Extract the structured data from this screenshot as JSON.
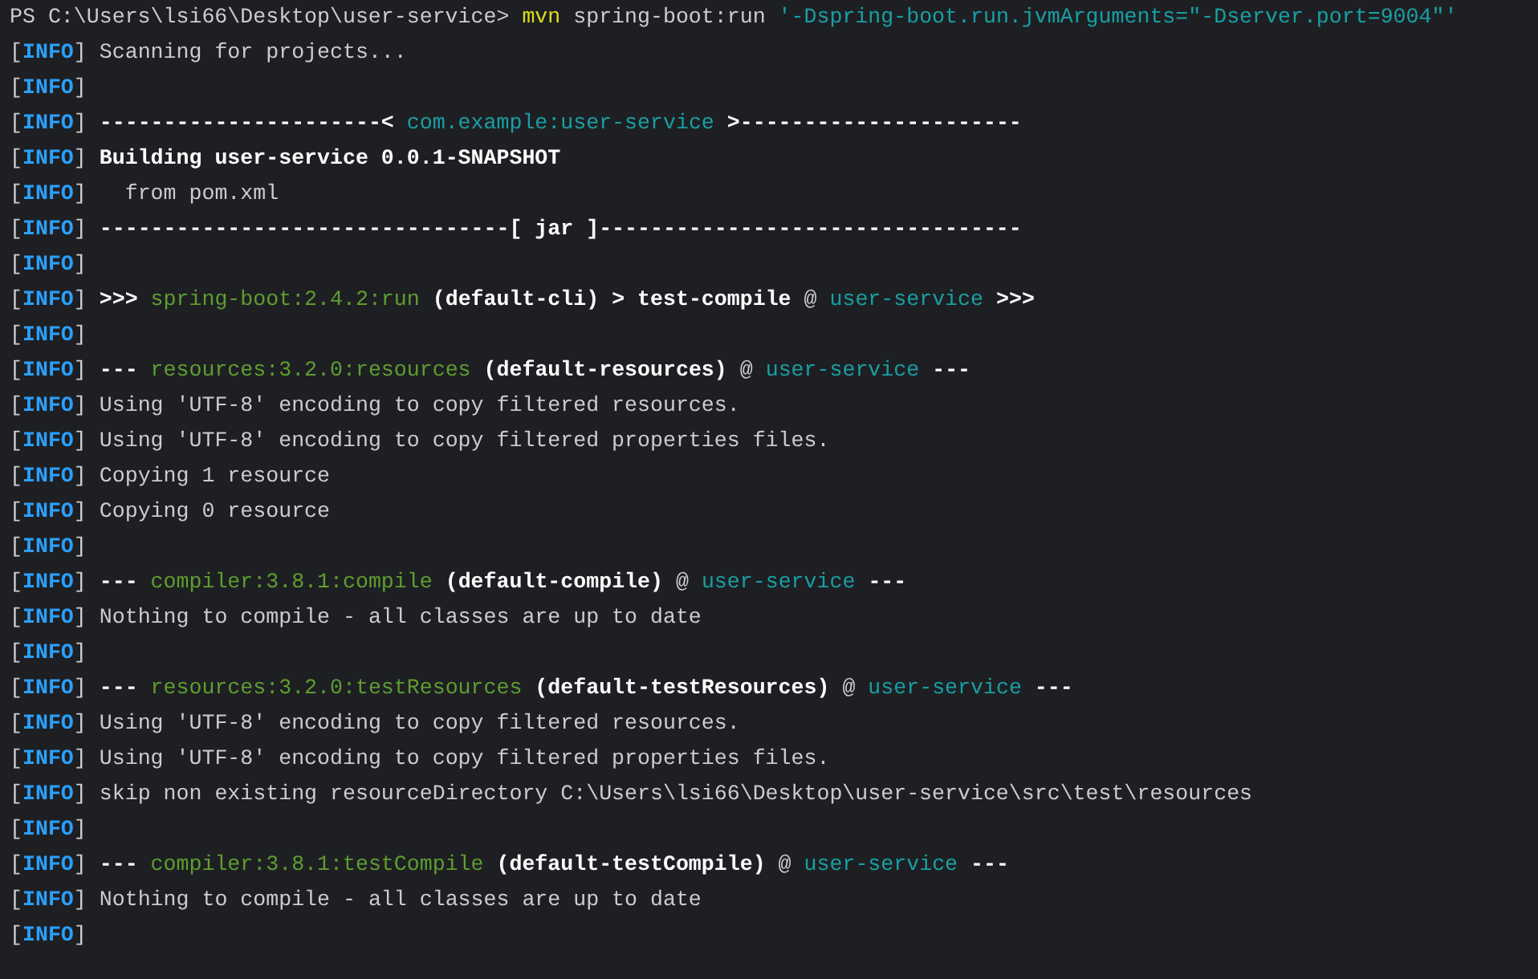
{
  "prompt": {
    "path": "PS C:\\Users\\lsi66\\Desktop\\user-service> ",
    "command": [
      {
        "text": "mvn",
        "kind": "yellow"
      },
      {
        "text": " spring-boot:run ",
        "kind": "plain"
      },
      {
        "text": "'-Dspring-boot.run.jvmArguments=\"-Dserver.port=9004\"'",
        "kind": "cyan"
      }
    ]
  },
  "level_brackets": {
    "open": "[",
    "close": "]"
  },
  "lines": [
    {
      "level": "INFO",
      "segments": [
        {
          "text": "Scanning for projects...",
          "kind": "plain"
        }
      ]
    },
    {
      "level": "INFO"
    },
    {
      "level": "INFO",
      "segments": [
        {
          "text": "----------------------< ",
          "kind": "bold"
        },
        {
          "text": "com.example:user-service",
          "kind": "cyan"
        },
        {
          "text": " >----------------------",
          "kind": "bold"
        }
      ]
    },
    {
      "level": "INFO",
      "segments": [
        {
          "text": "Building user-service 0.0.1-SNAPSHOT",
          "kind": "bold"
        }
      ]
    },
    {
      "level": "INFO",
      "segments": [
        {
          "text": "  from pom.xml",
          "kind": "plain"
        }
      ]
    },
    {
      "level": "INFO",
      "segments": [
        {
          "text": "--------------------------------[ jar ]---------------------------------",
          "kind": "bold"
        }
      ]
    },
    {
      "level": "INFO"
    },
    {
      "level": "INFO",
      "segments": [
        {
          "text": ">>> ",
          "kind": "bold"
        },
        {
          "text": "spring-boot:2.4.2:run",
          "kind": "green"
        },
        {
          "text": " (default-cli) > test-compile",
          "kind": "bold"
        },
        {
          "text": " @ ",
          "kind": "plain"
        },
        {
          "text": "user-service",
          "kind": "cyan"
        },
        {
          "text": " >>>",
          "kind": "bold"
        }
      ]
    },
    {
      "level": "INFO"
    },
    {
      "level": "INFO",
      "segments": [
        {
          "text": "--- ",
          "kind": "bold"
        },
        {
          "text": "resources:3.2.0:resources",
          "kind": "green"
        },
        {
          "text": " (default-resources)",
          "kind": "bold"
        },
        {
          "text": " @ ",
          "kind": "plain"
        },
        {
          "text": "user-service",
          "kind": "cyan"
        },
        {
          "text": " ---",
          "kind": "bold"
        }
      ]
    },
    {
      "level": "INFO",
      "segments": [
        {
          "text": "Using 'UTF-8' encoding to copy filtered resources.",
          "kind": "plain"
        }
      ]
    },
    {
      "level": "INFO",
      "segments": [
        {
          "text": "Using 'UTF-8' encoding to copy filtered properties files.",
          "kind": "plain"
        }
      ]
    },
    {
      "level": "INFO",
      "segments": [
        {
          "text": "Copying 1 resource",
          "kind": "plain"
        }
      ]
    },
    {
      "level": "INFO",
      "segments": [
        {
          "text": "Copying 0 resource",
          "kind": "plain"
        }
      ]
    },
    {
      "level": "INFO"
    },
    {
      "level": "INFO",
      "segments": [
        {
          "text": "--- ",
          "kind": "bold"
        },
        {
          "text": "compiler:3.8.1:compile",
          "kind": "green"
        },
        {
          "text": " (default-compile)",
          "kind": "bold"
        },
        {
          "text": " @ ",
          "kind": "plain"
        },
        {
          "text": "user-service",
          "kind": "cyan"
        },
        {
          "text": " ---",
          "kind": "bold"
        }
      ]
    },
    {
      "level": "INFO",
      "segments": [
        {
          "text": "Nothing to compile - all classes are up to date",
          "kind": "plain"
        }
      ]
    },
    {
      "level": "INFO"
    },
    {
      "level": "INFO",
      "segments": [
        {
          "text": "--- ",
          "kind": "bold"
        },
        {
          "text": "resources:3.2.0:testResources",
          "kind": "green"
        },
        {
          "text": " (default-testResources)",
          "kind": "bold"
        },
        {
          "text": " @ ",
          "kind": "plain"
        },
        {
          "text": "user-service",
          "kind": "cyan"
        },
        {
          "text": " ---",
          "kind": "bold"
        }
      ]
    },
    {
      "level": "INFO",
      "segments": [
        {
          "text": "Using 'UTF-8' encoding to copy filtered resources.",
          "kind": "plain"
        }
      ]
    },
    {
      "level": "INFO",
      "segments": [
        {
          "text": "Using 'UTF-8' encoding to copy filtered properties files.",
          "kind": "plain"
        }
      ]
    },
    {
      "level": "INFO",
      "segments": [
        {
          "text": "skip non existing resourceDirectory C:\\Users\\lsi66\\Desktop\\user-service\\src\\test\\resources",
          "kind": "plain"
        }
      ]
    },
    {
      "level": "INFO"
    },
    {
      "level": "INFO",
      "segments": [
        {
          "text": "--- ",
          "kind": "bold"
        },
        {
          "text": "compiler:3.8.1:testCompile",
          "kind": "green"
        },
        {
          "text": " (default-testCompile)",
          "kind": "bold"
        },
        {
          "text": " @ ",
          "kind": "plain"
        },
        {
          "text": "user-service",
          "kind": "cyan"
        },
        {
          "text": " ---",
          "kind": "bold"
        }
      ]
    },
    {
      "level": "INFO",
      "segments": [
        {
          "text": "Nothing to compile - all classes are up to date",
          "kind": "plain"
        }
      ]
    },
    {
      "level": "INFO"
    }
  ]
}
